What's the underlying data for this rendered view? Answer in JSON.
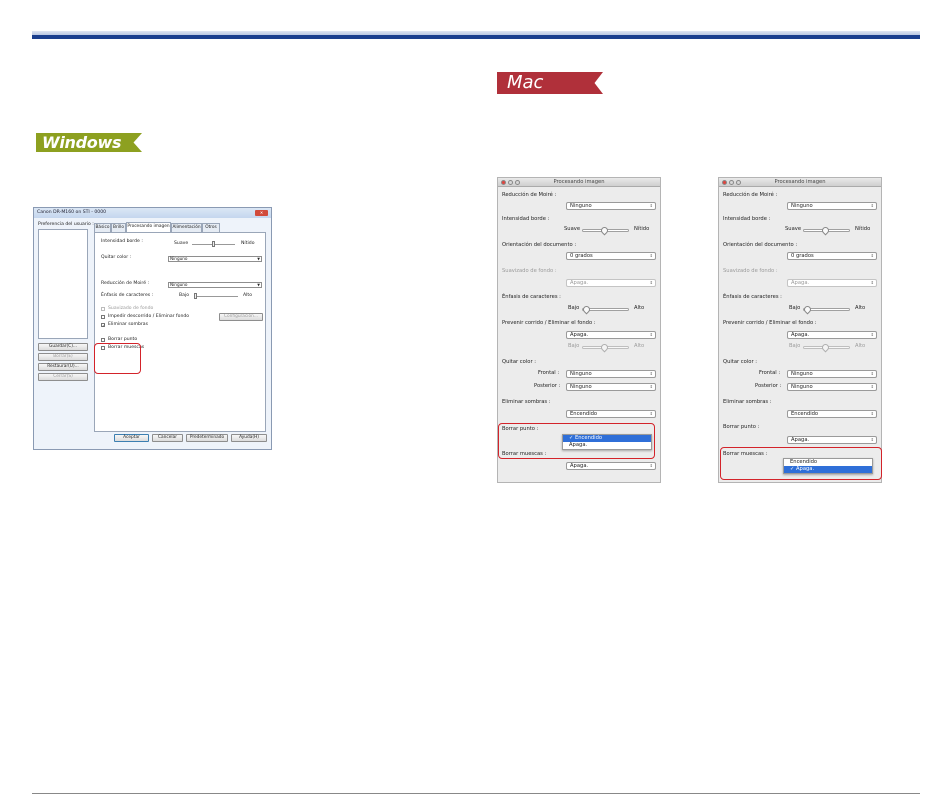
{
  "badges": {
    "windows": "Windows",
    "mac": "Mac"
  },
  "win": {
    "title": "Canon DR-M160 on STI - 0000",
    "user_prefs_label": "Preferencia del usuario :",
    "buttons": {
      "save": "Guardar(C)...",
      "delete": "Borrar(E)",
      "restore": "Restaurar(U)...",
      "close": "Cerrar(S)"
    },
    "tabs": [
      "Básico",
      "Brillo",
      "Procesando imagen",
      "Alimentación",
      "Otros"
    ],
    "edge_emphasis_label": "Intensidad borde :",
    "edge_low": "Suave",
    "edge_high": "Nítido",
    "remove_color_label": "Quitar color :",
    "remove_color_value": "Ninguno",
    "moire_label": "Reducción de Moiré :",
    "moire_value": "Ninguno",
    "char_emphasis_label": "Énfasis de caracteres :",
    "char_low": "Bajo",
    "char_high": "Alto",
    "bg_smooth_label": "Suavizado de fondo",
    "prevent_bleed_label": "Impedir descorrido / Eliminar fondo",
    "config_button": "Configuración...",
    "shadow_label": "Eliminar sombras",
    "erase_dot_label": "Borrar punto",
    "erase_notch_label": "Borrar muescas",
    "ok": "Aceptar",
    "cancel": "Cancelar",
    "default": "Predeterminado",
    "help": "Ayuda(H)"
  },
  "mac": {
    "title": "Procesando imagen",
    "moire_label": "Reducción de Moiré :",
    "moire_value": "Ninguno",
    "edge_label": "Intensidad borde :",
    "edge_low": "Suave",
    "edge_high": "Nítido",
    "orientation_label": "Orientación del documento :",
    "orientation_value": "0 grados",
    "bg_smooth_label": "Suavizado de fondo :",
    "bg_smooth_value": "Apaga.",
    "char_label": "Énfasis de caracteres :",
    "char_low": "Bajo",
    "char_high": "Alto",
    "prevent_label": "Prevenir corrido / Eliminar el fondo :",
    "prevent_value": "Apaga.",
    "prevent_low": "Bajo",
    "prevent_high": "Alto",
    "remove_color_label": "Quitar color :",
    "front_label": "Frontal :",
    "front_value": "Ninguno",
    "back_label": "Posterior :",
    "back_value": "Ninguno",
    "shadow_label": "Eliminar sombras :",
    "shadow_value": "Encendido",
    "erase_dot_label": "Borrar punto :",
    "erase_dot_value": "Apaga.",
    "erase_notch_label": "Borrar muescas :",
    "erase_notch_value": "Apaga.",
    "option_on": "✓ Encendido",
    "option_off": "Apaga.",
    "option_on_plain": "Encendido",
    "option_off_checked": "✓ Apaga."
  },
  "colors": {
    "highlight": "#d3232a",
    "menu_select": "#2f6fd8",
    "rule": "#1a3f8e"
  }
}
